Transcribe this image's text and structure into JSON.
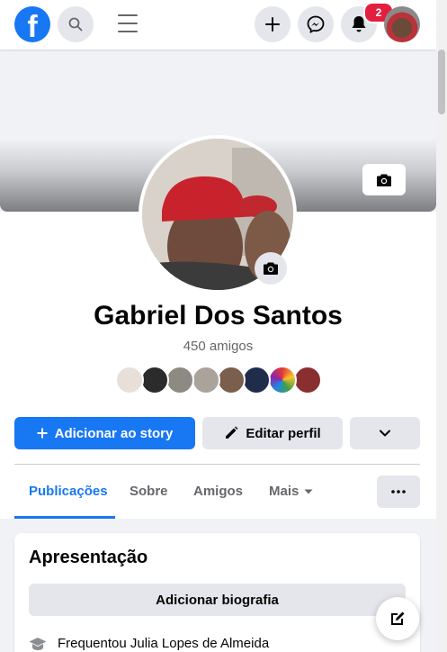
{
  "nav": {
    "logo": "f",
    "notification_count": "2",
    "icons": [
      "search-icon",
      "menu-icon",
      "plus-icon",
      "messenger-icon",
      "bell-icon"
    ]
  },
  "profile": {
    "name": "Gabriel Dos Santos",
    "friends_count": "450 amigos",
    "friend_avatar_count": 8
  },
  "actions": {
    "add_story": "Adicionar ao story",
    "edit_profile": "Editar perfil"
  },
  "tabs": [
    {
      "label": "Publicações",
      "active": true
    },
    {
      "label": "Sobre",
      "active": false
    },
    {
      "label": "Amigos",
      "active": false
    },
    {
      "label": "Mais",
      "active": false
    }
  ],
  "intro": {
    "title": "Apresentação",
    "add_bio": "Adicionar biografia",
    "education": "Frequentou Julia Lopes de Almeida"
  },
  "colors": {
    "brand": "#1877f2",
    "badge": "#e41e3f",
    "button_gray": "#e4e6eb",
    "muted_text": "#65676b"
  }
}
